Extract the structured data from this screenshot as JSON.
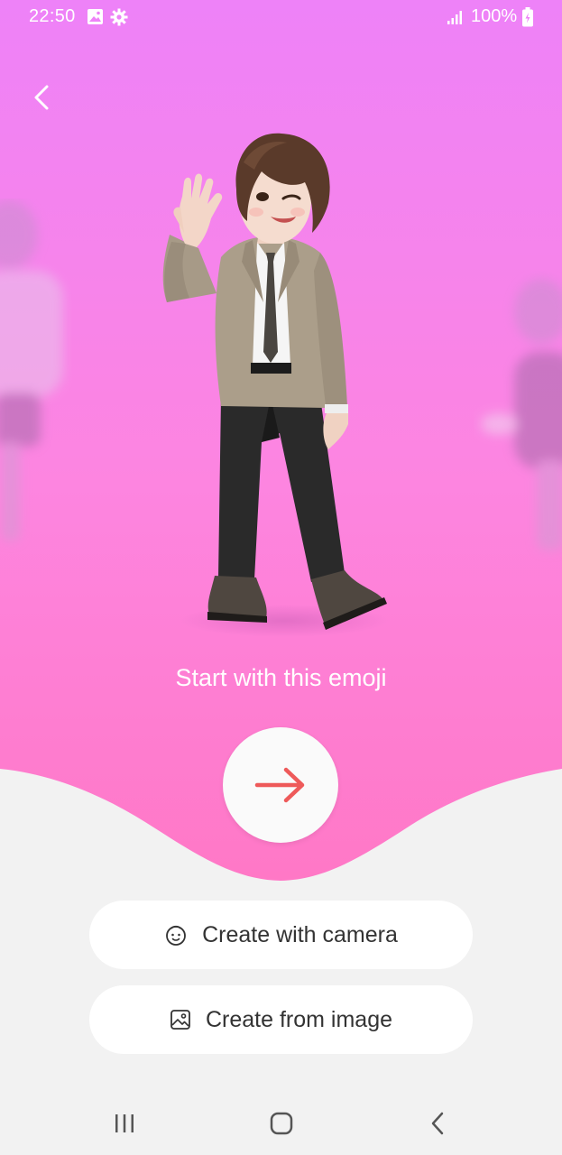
{
  "status_bar": {
    "time": "22:50",
    "battery": "100%",
    "icons": [
      "gallery-icon",
      "settings-icon",
      "signal-icon",
      "battery-charging-icon"
    ]
  },
  "header": {
    "back_icon": "chevron-left-icon"
  },
  "main": {
    "prompt_text": "Start with this emoji",
    "next_icon": "arrow-right-icon",
    "accent_color": "#ee5a5a",
    "gradient_top": "#ee82f8",
    "gradient_bottom": "#ff79c8"
  },
  "actions": {
    "camera_label": "Create with camera",
    "camera_icon": "face-icon",
    "image_label": "Create from image",
    "image_icon": "image-icon"
  },
  "nav_bar": {
    "recents_icon": "recents-icon",
    "home_icon": "home-icon",
    "back_icon": "back-icon"
  }
}
